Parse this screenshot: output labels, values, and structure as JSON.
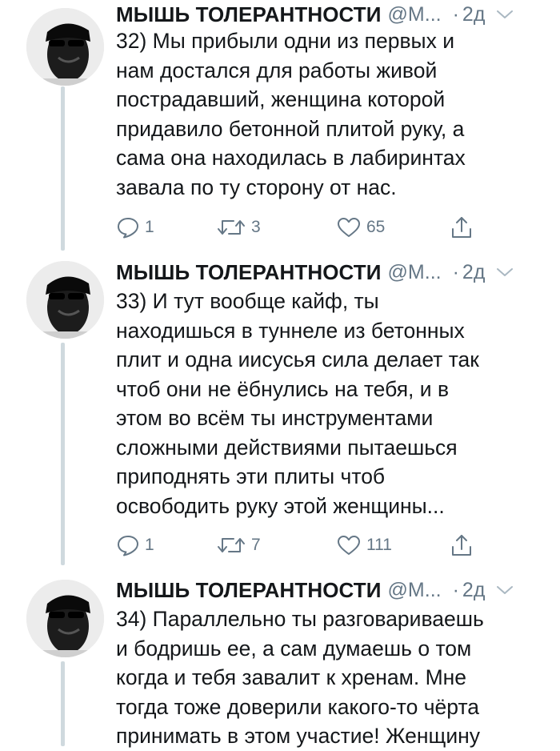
{
  "tweets": [
    {
      "author": {
        "name": "МЫШЬ ТОЛЕРАНТНОСТИ",
        "handle": "@M...",
        "separator": "·",
        "time": "2д"
      },
      "text": "32) Мы прибыли одни из первых и\nнам достался для работы живой\nпострадавший, женщина которой\nпридавило бетонной плитой руку, а\nсама она находилась в лабиринтах\nзавала по ту сторону от нас.",
      "stats": {
        "replies": "1",
        "retweets": "3",
        "likes": "65"
      }
    },
    {
      "author": {
        "name": "МЫШЬ ТОЛЕРАНТНОСТИ",
        "handle": "@M...",
        "separator": "·",
        "time": "2д"
      },
      "text": "33) И тут вообще кайф, ты\nнаходишься в туннеле из бетонных\nплит и одна иисусья сила делает так\nчтоб они не ёбнулись на тебя, и в\nэтом во всём ты инструментами\nсложными действиями пытаешься\nприподнять эти плиты чтоб\nосвободить руку этой женщины...",
      "stats": {
        "replies": "1",
        "retweets": "7",
        "likes": "111"
      }
    },
    {
      "author": {
        "name": "МЫШЬ ТОЛЕРАНТНОСТИ",
        "handle": "@M...",
        "separator": "·",
        "time": "2д"
      },
      "text": "34) Параллельно ты разговариваешь\nи бодришь ее, а сам думаешь о том\nкогда и тебя завалит к хренам. Мне\nтогда тоже доверили какого-то чёрта\nпринимать в этом участие! Женщину"
    }
  ],
  "icons": {
    "reply": "reply-icon",
    "retweet": "retweet-icon",
    "like": "heart-icon",
    "share": "share-icon",
    "caret": "chevron-down-icon"
  },
  "colors": {
    "text": "#14171a",
    "secondary": "#657786",
    "thread_line": "#cfd9de"
  }
}
